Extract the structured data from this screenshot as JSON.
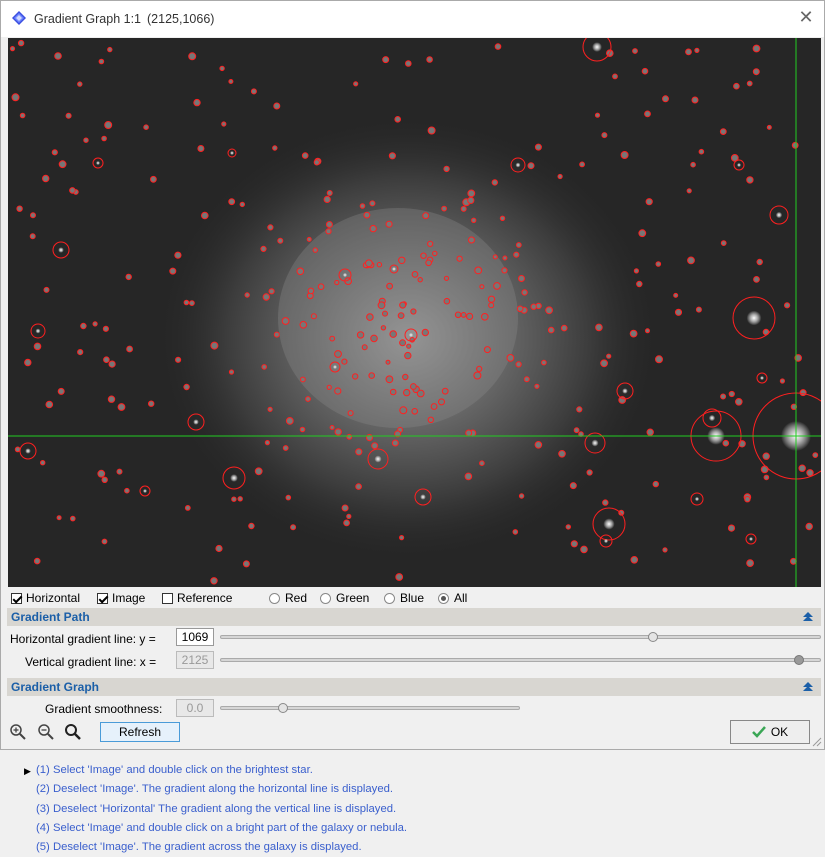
{
  "window": {
    "title": "Gradient Graph 1:1",
    "coords": "(2125,1066)"
  },
  "options": {
    "horizontal": {
      "label": "Horizontal",
      "checked": true
    },
    "image": {
      "label": "Image",
      "checked": true
    },
    "reference": {
      "label": "Reference",
      "checked": false
    },
    "channels": [
      {
        "label": "Red",
        "selected": false
      },
      {
        "label": "Green",
        "selected": false
      },
      {
        "label": "Blue",
        "selected": false
      },
      {
        "label": "All",
        "selected": true
      }
    ]
  },
  "gradient_path": {
    "title": "Gradient Path",
    "horizontal_label": "Horizontal gradient line: y =",
    "horizontal_value": "1069",
    "horizontal_position": 0.73,
    "vertical_label": "Vertical gradient line: x =",
    "vertical_value": "2125",
    "vertical_position": 0.98
  },
  "gradient_graph": {
    "title": "Gradient Graph",
    "smoothness_label": "Gradient smoothness:",
    "smoothness_value": "0.0",
    "smoothness_position": 0.2
  },
  "buttons": {
    "refresh": "Refresh",
    "ok": "OK"
  },
  "instructions": [
    "(1) Select 'Image' and double click on the brightest star.",
    "(2) Deselect 'Image'. The gradient along the horizontal line is displayed.",
    "(3) Deselect 'Horizontal' The gradient along the vertical line is displayed.",
    "(4) Select 'Image' and double click on a bright part of the galaxy or nebula.",
    "(5) Deselect 'Image'. The gradient across the galaxy is displayed."
  ],
  "colors": {
    "section_title": "#1b5fa8",
    "instruction_text": "#3a5fcd",
    "crosshair": "#22cc22",
    "star_marker": "#ff2020",
    "ok_check": "#3aa655"
  }
}
